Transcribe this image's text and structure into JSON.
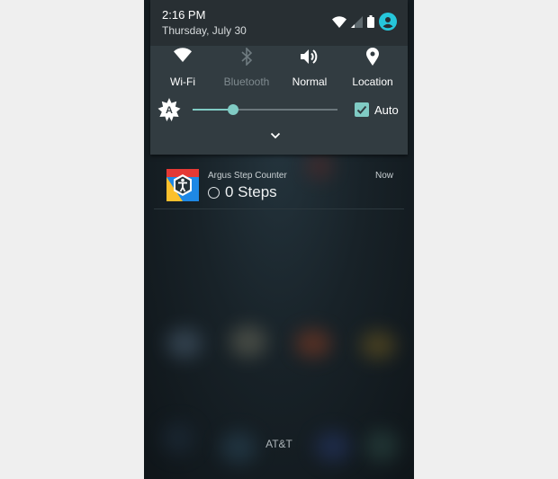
{
  "status_bar": {
    "time": "2:16 PM",
    "date": "Thursday, July 30",
    "icons": [
      "wifi-icon",
      "cell-signal-icon",
      "battery-icon",
      "account-icon"
    ]
  },
  "quick_settings": {
    "tiles": [
      {
        "label": "Wi-Fi",
        "icon": "wifi-icon",
        "enabled": true
      },
      {
        "label": "Bluetooth",
        "icon": "bluetooth-icon",
        "enabled": false
      },
      {
        "label": "Normal",
        "icon": "volume-icon",
        "enabled": true
      },
      {
        "label": "Location",
        "icon": "location-pin-icon",
        "enabled": true
      }
    ],
    "brightness": {
      "level_percent": 28,
      "auto_label": "Auto",
      "auto_checked": true
    },
    "expand_icon": "chevron-down-icon"
  },
  "notification": {
    "app_name": "Argus Step Counter",
    "time": "Now",
    "text": "0 Steps"
  },
  "carrier": "AT&T",
  "colors": {
    "accent": "#80cbc4",
    "panel": "#323c41",
    "header": "#282f33"
  }
}
